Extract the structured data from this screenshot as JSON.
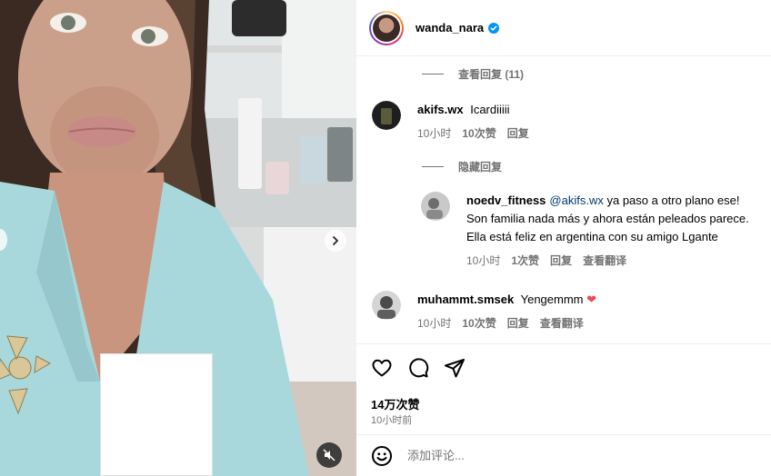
{
  "post": {
    "username": "wanda_nara",
    "verified": true
  },
  "replies_toggle_1": "查看回复 (11)",
  "replies_toggle_2": "隐藏回复",
  "comments": [
    {
      "username": "akifs.wx",
      "text": "Icardiiiii",
      "time": "10小时",
      "likes": "10次赞",
      "reply": "回复"
    },
    {
      "username": "noedv_fitness",
      "mention": "@akifs.wx",
      "text_line1": " ya paso a otro plano ese!",
      "text_line2": "Son familia nada más y ahora están peleados parece.",
      "text_line3": "Ella está feliz en argentina con su amigo Lgante",
      "time": "10小时",
      "likes": "1次赞",
      "reply": "回复",
      "translate": "查看翻译"
    },
    {
      "username": "muhammt.smsek",
      "text": "Yengemmm",
      "emoji": "❤",
      "time": "10小时",
      "likes": "10次赞",
      "reply": "回复",
      "translate": "查看翻译"
    }
  ],
  "stats": {
    "likes": "14万次赞",
    "posted": "10小时前"
  },
  "composer": {
    "placeholder": "添加评论..."
  },
  "icons": {
    "heart": "heart-icon",
    "comment": "comment-icon",
    "share": "share-icon",
    "emoji": "emoji-icon",
    "next": "chevron-right-icon",
    "mute": "muted-speaker-icon",
    "verified": "verified-badge-icon"
  },
  "colors": {
    "verified": "#0095f6",
    "mention": "#00376b",
    "secondary_text": "#737373",
    "heart_emoji": "#ed4956"
  }
}
